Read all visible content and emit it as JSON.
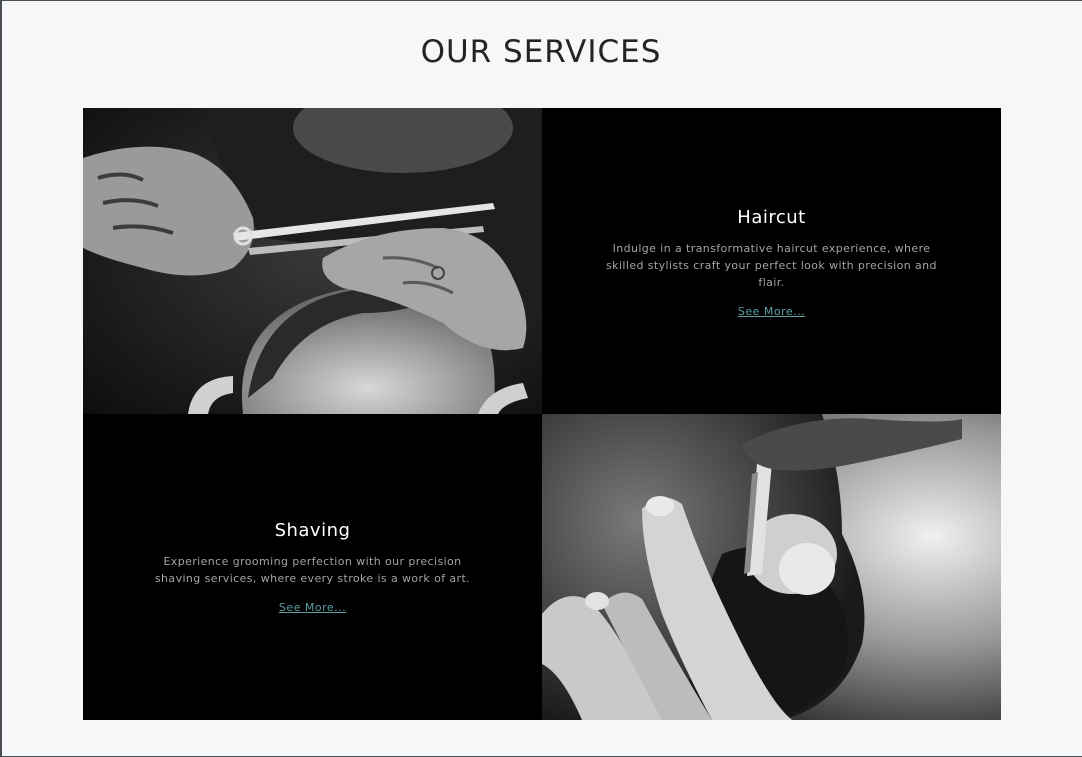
{
  "section": {
    "title": "OUR SERVICES"
  },
  "services": [
    {
      "title": "Haircut",
      "description": "Indulge in a transformative haircut experience, where skilled stylists craft your perfect look with precision and flair.",
      "link_label": "See More..."
    },
    {
      "title": "Shaving",
      "description": "Experience grooming perfection with our precision shaving services, where every stroke is a work of art.",
      "link_label": "See More..."
    }
  ],
  "colors": {
    "page_background": "#f6f7f9",
    "card_background": "#000000",
    "title_text": "#222426",
    "link": "#5e9ea0",
    "description": "#a3a3a3"
  },
  "images": [
    {
      "name": "haircut-photo",
      "depicts": "barber cutting hair with scissors and comb"
    },
    {
      "name": "shaving-photo",
      "depicts": "barber shaving a beard with a straight razor"
    }
  ]
}
